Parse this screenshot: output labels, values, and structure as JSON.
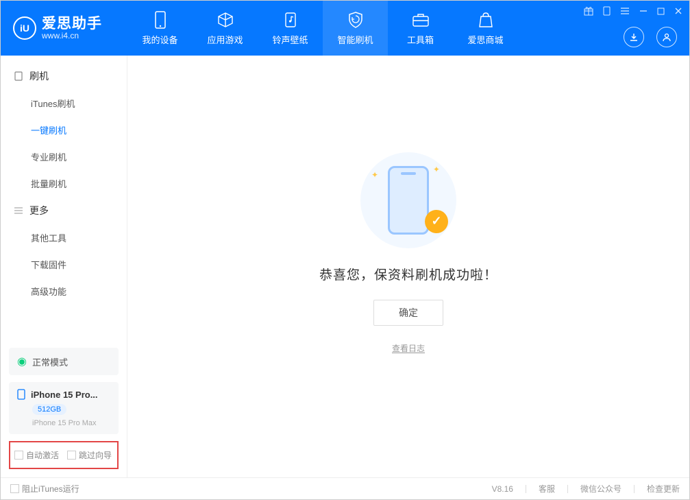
{
  "app": {
    "name": "爱思助手",
    "site": "www.i4.cn"
  },
  "nav": [
    {
      "label": "我的设备",
      "icon": "phone-icon"
    },
    {
      "label": "应用游戏",
      "icon": "cube-icon"
    },
    {
      "label": "铃声壁纸",
      "icon": "note-icon"
    },
    {
      "label": "智能刷机",
      "icon": "shield-icon",
      "active": true
    },
    {
      "label": "工具箱",
      "icon": "toolbox-icon"
    },
    {
      "label": "爱思商城",
      "icon": "bag-icon"
    }
  ],
  "sidebar": {
    "groups": [
      {
        "label": "刷机",
        "items": [
          "iTunes刷机",
          "一键刷机",
          "专业刷机",
          "批量刷机"
        ],
        "activeIndex": 1
      },
      {
        "label": "更多",
        "items": [
          "其他工具",
          "下载固件",
          "高级功能"
        ],
        "activeIndex": -1
      }
    ]
  },
  "status": {
    "label": "正常模式"
  },
  "device": {
    "name": "iPhone 15 Pro...",
    "storage": "512GB",
    "full": "iPhone 15 Pro Max"
  },
  "checkboxes": {
    "autoActivate": "自动激活",
    "skipWizard": "跳过向导"
  },
  "main": {
    "successMsg": "恭喜您，保资料刷机成功啦！",
    "okBtn": "确定",
    "logLink": "查看日志"
  },
  "footer": {
    "blockItunes": "阻止iTunes运行",
    "version": "V8.16",
    "links": [
      "客服",
      "微信公众号",
      "检查更新"
    ]
  }
}
